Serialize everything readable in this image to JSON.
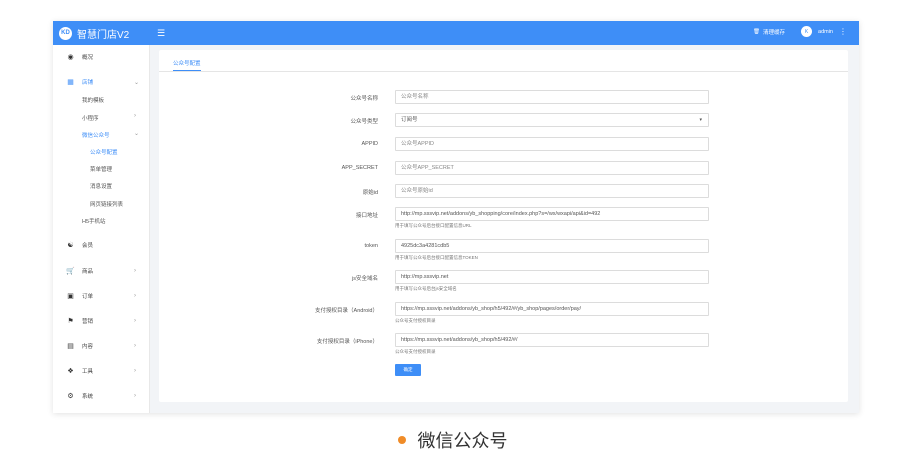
{
  "header": {
    "app_name": "智慧门店V2",
    "logo_text": "KD",
    "menu_icon": "hamburger-icon",
    "clear_cache": "清理缓存",
    "user_initial": "K",
    "user_name": "admin",
    "brand_color": "#3e8ef7"
  },
  "sidebar": {
    "items": [
      {
        "label": "概况",
        "icon": "dashboard-icon"
      },
      {
        "label": "店铺",
        "icon": "grid-icon"
      },
      {
        "label": "会员",
        "icon": "users-icon"
      },
      {
        "label": "商品",
        "icon": "cart-icon"
      },
      {
        "label": "订单",
        "icon": "order-icon"
      },
      {
        "label": "营销",
        "icon": "flag-icon"
      },
      {
        "label": "内容",
        "icon": "document-icon"
      },
      {
        "label": "工具",
        "icon": "tools-icon"
      },
      {
        "label": "系统",
        "icon": "gear-icon"
      }
    ],
    "store_sub": [
      "我的模板",
      "小程序",
      "微信公众号",
      "H5手机站"
    ],
    "wechat_sub": [
      "公众号配置",
      "菜单管理",
      "消息设置",
      "网页链接列表"
    ]
  },
  "main": {
    "tab": "公众号配置",
    "fields": [
      {
        "label": "公众号名称",
        "value": "公众号名称",
        "placeholder": true
      },
      {
        "label": "公众号类型",
        "value": "订阅号",
        "placeholder": false
      },
      {
        "label": "APPID",
        "value": "公众号APPID",
        "placeholder": true
      },
      {
        "label": "APP_SECRET",
        "value": "公众号APP_SECRET",
        "placeholder": true
      },
      {
        "label": "原始id",
        "value": "公众号原始id",
        "placeholder": true
      },
      {
        "label": "接口地址",
        "value": "http://mp.sssvip.net/addons/yb_shopping/core/index.php?s=/wx/wxapi/api&id=492",
        "hint": "用于填写公众号后台接口配置信息URL"
      },
      {
        "label": "token",
        "value": "4925dc3a4281cdb5",
        "hint": "用于填写公众号后台接口配置信息TOKEN"
      },
      {
        "label": "js安全域名",
        "value": "http://mp.sssvip.net",
        "hint": "用于填写公众号后台js安全域名"
      },
      {
        "label": "支付授权目录（Android）",
        "value": "https://mp.sssvip.net/addons/yb_shop/h5/492/#/yb_shop/pages/order/pay/",
        "hint": "公众号支付授权目录"
      },
      {
        "label": "支付授权目录（iPhone）",
        "value": "https://mp.sssvip.net/addons/yb_shop/h5/492/#/",
        "hint": "公众号支付授权目录"
      }
    ],
    "submit_label": "确定"
  },
  "caption": {
    "text": "微信公众号",
    "dot_color": "#f08c28"
  }
}
